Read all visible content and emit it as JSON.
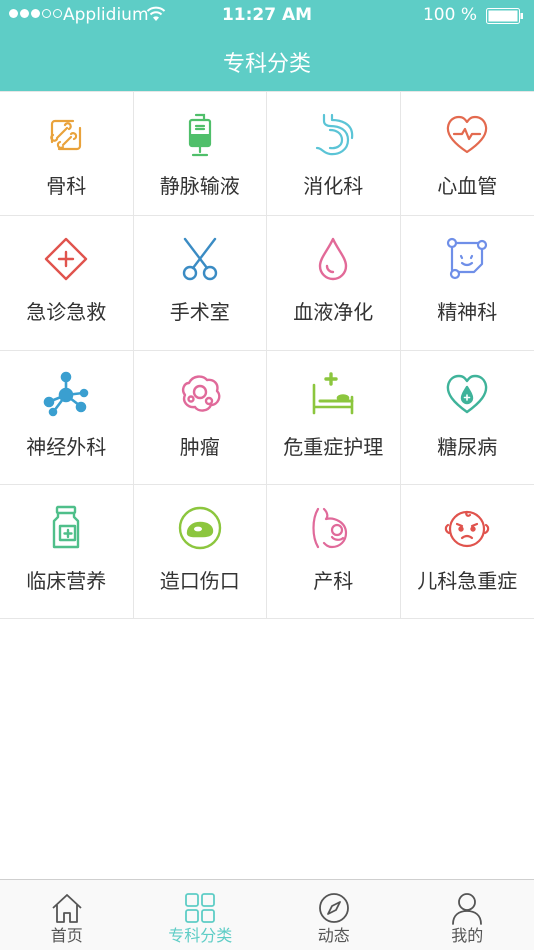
{
  "status_bar": {
    "carrier": "Applidium",
    "time": "11:27 AM",
    "battery": "100 %"
  },
  "nav": {
    "title": "专科分类"
  },
  "departments": [
    {
      "label": "骨科",
      "icon": "bone-icon",
      "color": "#e9a23b"
    },
    {
      "label": "静脉输液",
      "icon": "iv-drip-icon",
      "color": "#4fbf6a"
    },
    {
      "label": "消化科",
      "icon": "stomach-icon",
      "color": "#5bc4d6"
    },
    {
      "label": "心血管",
      "icon": "heart-pulse-icon",
      "color": "#e36a4f"
    },
    {
      "label": "急诊急救",
      "icon": "emergency-icon",
      "color": "#e0534d"
    },
    {
      "label": "手术室",
      "icon": "scissors-icon",
      "color": "#3b8cc4"
    },
    {
      "label": "血液净化",
      "icon": "blood-drop-icon",
      "color": "#e26a98"
    },
    {
      "label": "精神科",
      "icon": "brain-nodes-icon",
      "color": "#6f8fe8"
    },
    {
      "label": "神经外科",
      "icon": "neuron-icon",
      "color": "#3a9fd0"
    },
    {
      "label": "肿瘤",
      "icon": "tumor-cell-icon",
      "color": "#e06a9a"
    },
    {
      "label": "危重症护理",
      "icon": "hospital-bed-icon",
      "color": "#8cc63e"
    },
    {
      "label": "糖尿病",
      "icon": "heart-drop-icon",
      "color": "#3fb39a"
    },
    {
      "label": "临床营养",
      "icon": "nutrition-bottle-icon",
      "color": "#4fbf8a"
    },
    {
      "label": "造口伤口",
      "icon": "stoma-icon",
      "color": "#8cc63e"
    },
    {
      "label": "产科",
      "icon": "pregnancy-icon",
      "color": "#e06a9a"
    },
    {
      "label": "儿科急重症",
      "icon": "baby-face-icon",
      "color": "#e0534d"
    }
  ],
  "tabs": [
    {
      "label": "首页",
      "icon": "home-icon",
      "active": false
    },
    {
      "label": "专科分类",
      "icon": "grid-icon",
      "active": true
    },
    {
      "label": "动态",
      "icon": "compass-icon",
      "active": false
    },
    {
      "label": "我的",
      "icon": "user-icon",
      "active": false
    }
  ],
  "colors": {
    "header": "#5ecdc6",
    "active_tab": "#5ecdc6",
    "text": "#333333"
  }
}
